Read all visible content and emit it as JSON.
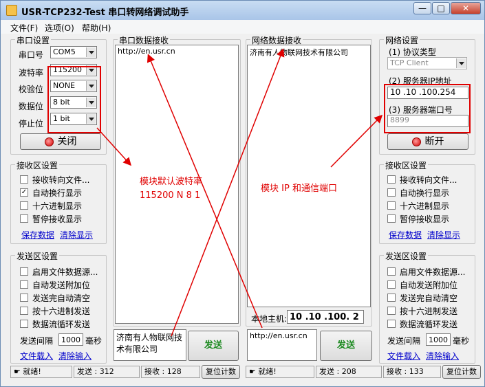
{
  "window": {
    "title": "USR-TCP232-Test 串口转网络调试助手",
    "min": "—",
    "max": "□",
    "close": "✕"
  },
  "menu": [
    "文件(F)",
    "选项(O)",
    "帮助(H)"
  ],
  "serial": {
    "title": "串口设置",
    "port_label": "串口号",
    "port": "COM5",
    "baud_label": "波特率",
    "baud": "115200",
    "parity_label": "校验位",
    "parity": "NONE",
    "data_label": "数据位",
    "data_bits": "8 bit",
    "stop_label": "停止位",
    "stop_bits": "1 bit",
    "close_btn": "关闭"
  },
  "net": {
    "title": "网络设置",
    "proto_label": "(1) 协议类型",
    "proto": "TCP Client",
    "ip_label": "(2) 服务器IP地址",
    "ip": "10 .10 .100.254",
    "port_label": "(3) 服务器端口号",
    "port": "8899",
    "open_btn": "断开"
  },
  "serial_recv": {
    "title": "串口数据接收",
    "text": "http://en.usr.cn"
  },
  "net_recv": {
    "title": "网络数据接收",
    "text": "济南有人物联网技术有限公司"
  },
  "left_recv": {
    "title": "接收区设置",
    "opts": [
      "接收转向文件...",
      "自动换行显示",
      "十六进制显示",
      "暂停接收显示"
    ],
    "save": "保存数据",
    "clear": "清除显示"
  },
  "right_recv": {
    "title": "接收区设置",
    "opts": [
      "接收转向文件...",
      "自动换行显示",
      "十六进制显示",
      "暂停接收显示"
    ],
    "save": "保存数据",
    "clear": "清除显示"
  },
  "left_send": {
    "title": "发送区设置",
    "opts": [
      "启用文件数据源...",
      "自动发送附加位",
      "发送完自动清空",
      "按十六进制发送",
      "数据流循环发送"
    ],
    "interval_label": "发送间隔",
    "interval": "1000",
    "unit": "毫秒",
    "file": "文件载入",
    "clear": "清除输入"
  },
  "right_send": {
    "title": "发送区设置",
    "opts": [
      "启用文件数据源...",
      "自动发送附加位",
      "发送完自动清空",
      "按十六进制发送",
      "数据流循环发送"
    ],
    "interval_label": "发送间隔",
    "interval": "1000",
    "unit": "毫秒",
    "file": "文件载入",
    "clear": "清除输入"
  },
  "local_host": {
    "label": "本地主机:",
    "value": "10 .10 .100. 2"
  },
  "send_serial": {
    "text": "济南有人物联网技术有限公司",
    "btn": "发送"
  },
  "send_net": {
    "text": "http://en.usr.cn",
    "btn": "发送"
  },
  "status_left": {
    "ready": "就绪!",
    "sent": "发送 : 312",
    "recv": "接收 : 128",
    "reset": "复位计数"
  },
  "status_right": {
    "ready": "就绪!",
    "sent": "发送 : 208",
    "recv": "接收 : 133",
    "reset": "复位计数"
  },
  "annotations": {
    "a1": "模块默认波特率",
    "a2": "115200 N 8 1",
    "a3": "模块 IP 和通信端口"
  },
  "colors": {
    "accent": "#e00000"
  }
}
